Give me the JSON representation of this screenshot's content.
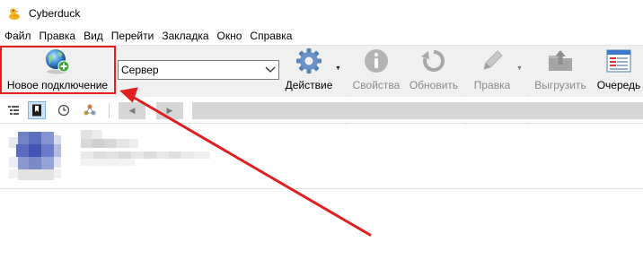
{
  "window": {
    "title": "Cyberduck"
  },
  "menu": [
    "Файл",
    "Правка",
    "Вид",
    "Перейти",
    "Закладка",
    "Окно",
    "Справка"
  ],
  "toolbar": {
    "new_connection": "Новое подключение",
    "server_value": "Сервер",
    "action": "Действие",
    "properties": "Свойства",
    "refresh": "Обновить",
    "edit": "Правка",
    "upload": "Выгрузить",
    "queue": "Очередь"
  },
  "colors": {
    "highlight": "#e02020",
    "annotation_arrow": "#e02020",
    "toolbar_bg": "#f0f0f0"
  },
  "annotation": {
    "type": "arrow",
    "points_to": "new-connection-button"
  }
}
